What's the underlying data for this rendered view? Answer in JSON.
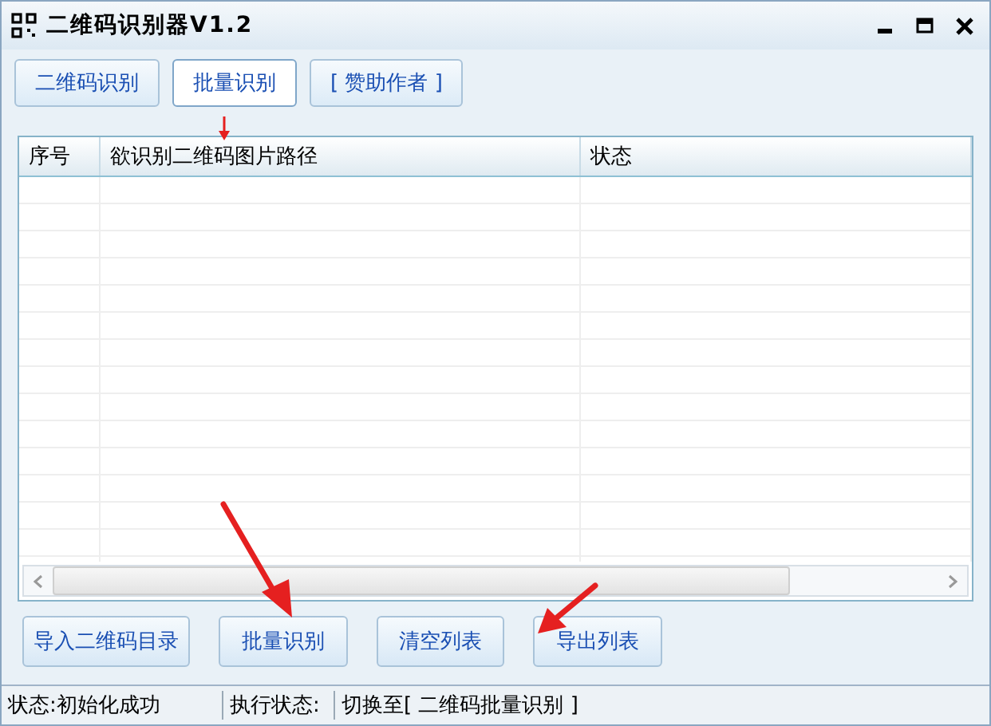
{
  "window": {
    "title": "二维码识别器V1.2"
  },
  "tabs": [
    {
      "label": "二维码识别",
      "selected": false
    },
    {
      "label": "批量识别",
      "selected": true
    },
    {
      "label": "[ 赞助作者 ]",
      "selected": false
    }
  ],
  "table": {
    "columns": [
      "序号",
      "欲识别二维码图片路径",
      "状态"
    ]
  },
  "buttons": [
    "导入二维码目录",
    "批量识别",
    "清空列表",
    "导出列表"
  ],
  "status_bar": [
    "状态:初始化成功",
    "执行状态:",
    "切换至[ 二维码批量识别 ]"
  ]
}
